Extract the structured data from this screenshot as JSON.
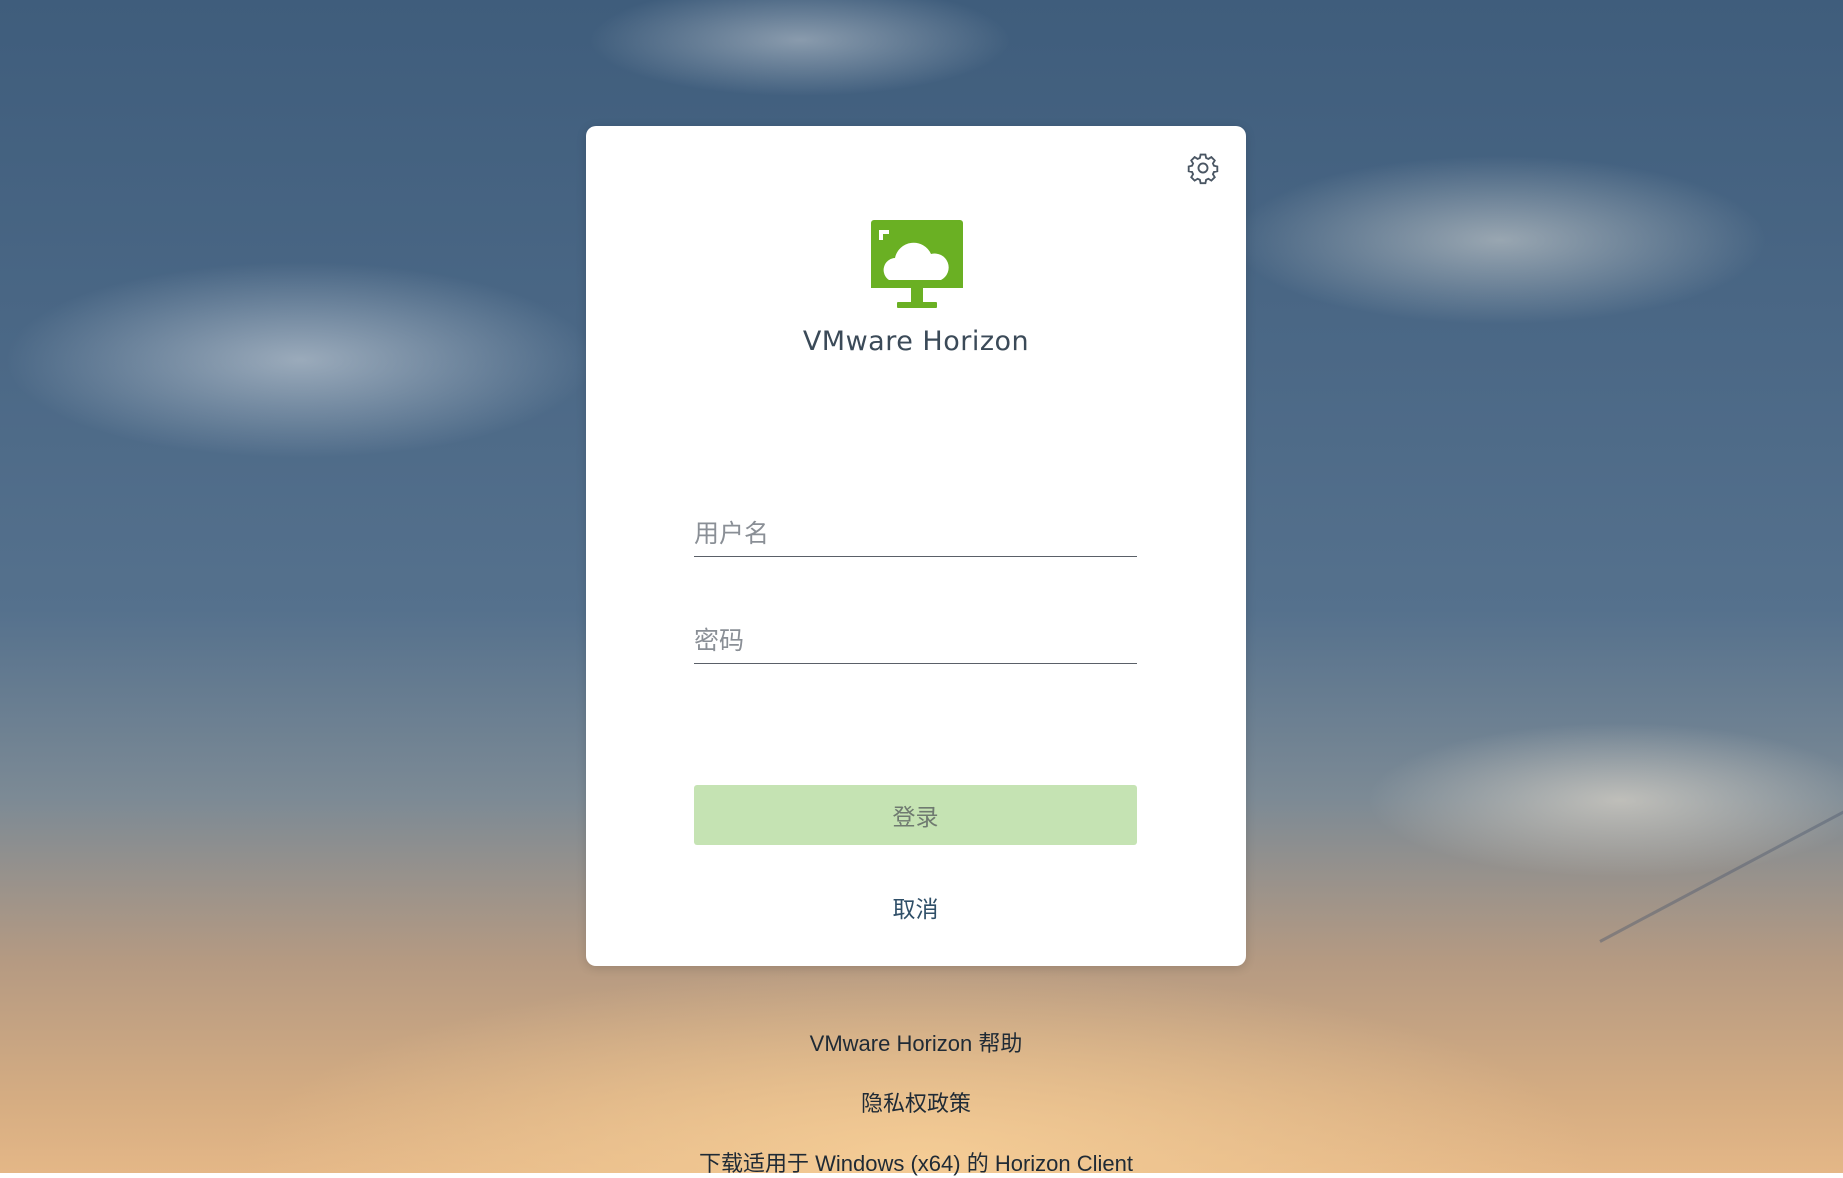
{
  "login_card": {
    "settings_icon": "gear-icon",
    "logo_icon": "vmware-horizon-monitor-cloud-logo",
    "app_name": "VMware Horizon",
    "username": {
      "value": "",
      "placeholder": "用户名"
    },
    "password": {
      "value": "",
      "placeholder": "密码"
    },
    "login_button_label": "登录",
    "cancel_label": "取消"
  },
  "footer": {
    "help_link": "VMware Horizon 帮助",
    "privacy_link": "隐私权政策",
    "download_link": "下载适用于 Windows (x64) 的 Horizon Client"
  },
  "colors": {
    "brand_green": "#6ab023",
    "login_button_bg": "#c5e3b3",
    "card_bg": "#ffffff",
    "link_color": "#2f4f68"
  }
}
